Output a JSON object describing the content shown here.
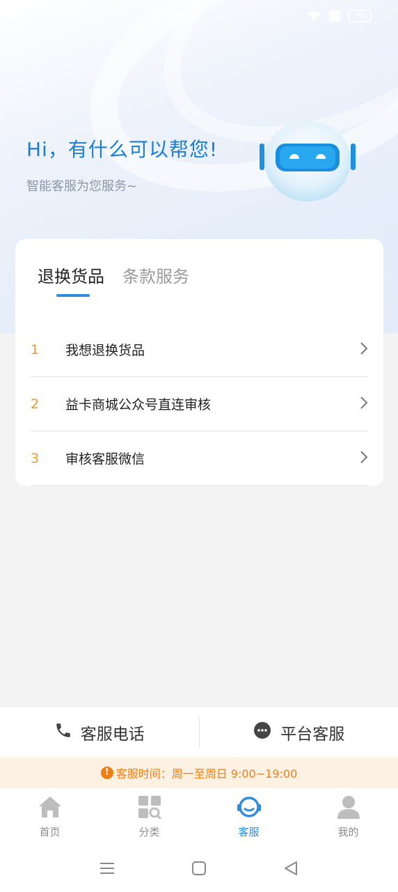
{
  "status_bar": {
    "time": "10:14",
    "battery": "99"
  },
  "hero": {
    "greeting": "Hi，有什么可以帮您!",
    "subtitle": "智能客服为您服务~"
  },
  "tabs": [
    {
      "label": "退换货品",
      "active": true
    },
    {
      "label": "条款服务",
      "active": false
    }
  ],
  "faq": [
    {
      "num": "1",
      "text": "我想退换货品"
    },
    {
      "num": "2",
      "text": "益卡商城公众号直连审核"
    },
    {
      "num": "3",
      "text": "审核客服微信"
    }
  ],
  "contact": {
    "phone_label": "客服电话",
    "platform_label": "平台客服"
  },
  "service_hours": "客服时间：周一至周日 9:00~19:00",
  "bottom_nav": [
    {
      "label": "首页",
      "icon": "home-icon"
    },
    {
      "label": "分类",
      "icon": "category-icon"
    },
    {
      "label": "客服",
      "icon": "customer-service-icon",
      "active": true
    },
    {
      "label": "我的",
      "icon": "profile-icon"
    }
  ],
  "colors": {
    "accent": "#2e8be0",
    "orange": "#f07e12",
    "number": "#e69a2e"
  }
}
